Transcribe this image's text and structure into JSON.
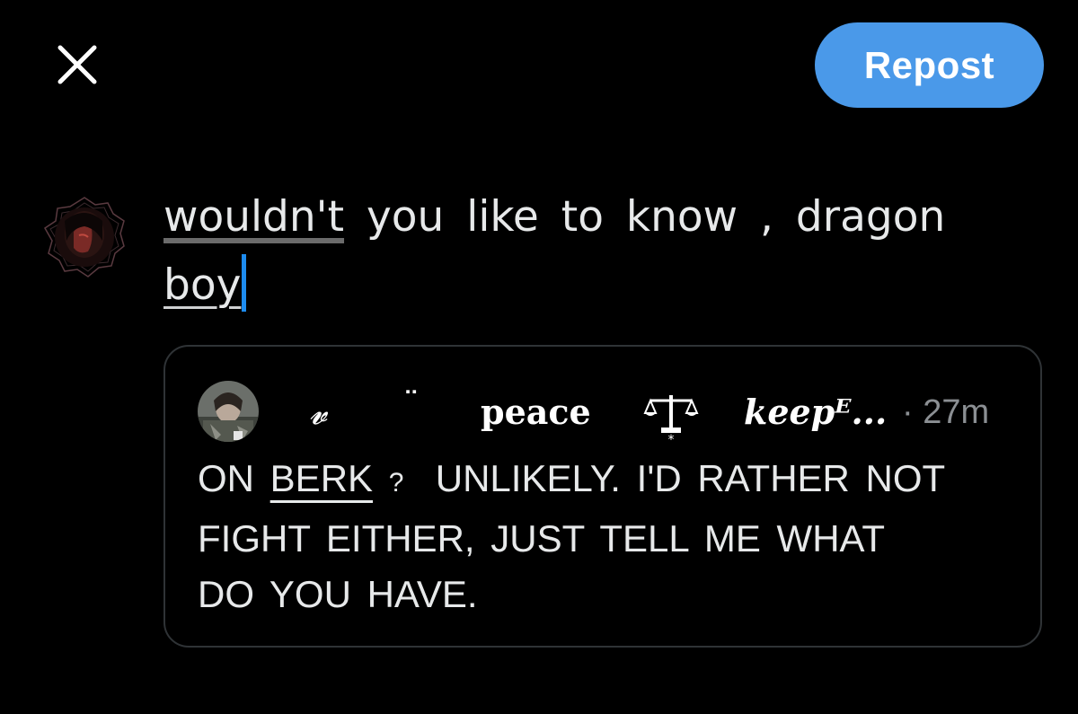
{
  "toolbar": {
    "close_icon": "close-icon",
    "repost_label": "Repost",
    "accent_color": "#4a99e9"
  },
  "composer": {
    "word_misspelled": "wouldn't",
    "line1_rest": "you like to know , dragon",
    "line2_word": "boy",
    "caret_color": "#1d8cf0"
  },
  "quoted_post": {
    "name_part1": "𝓿",
    "name_part2": "¨",
    "name_part3": "peace",
    "name_icon": "scales-icon",
    "name_part4": "keepᴱ...",
    "separator": "·",
    "time": "27m",
    "body_line1_pre": "ON",
    "body_berk": "BERK",
    "body_q": "?",
    "body_line1_post": "UNLIKELY. I'D RATHER NOT",
    "body_line2": "FIGHT EITHER,  JUST TELL ME WHAT",
    "body_line3": "DO YOU HAVE."
  }
}
